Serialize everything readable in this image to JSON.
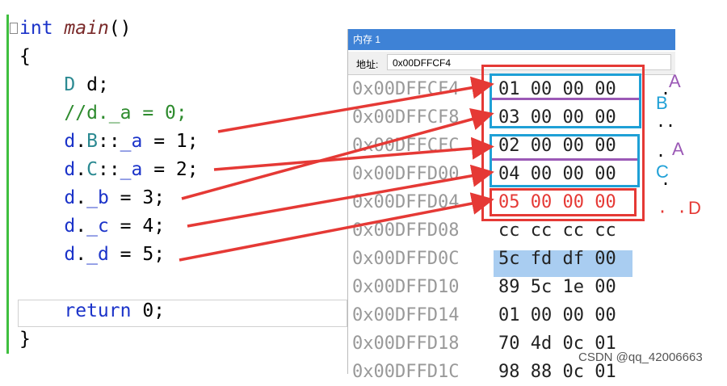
{
  "editor": {
    "lines": [
      {
        "parts": [
          {
            "t": "int",
            "c": "kw"
          },
          {
            "t": " ",
            "c": ""
          },
          {
            "t": "main",
            "c": "fn"
          },
          {
            "t": "()",
            "c": ""
          }
        ]
      },
      {
        "parts": [
          {
            "t": "{",
            "c": ""
          }
        ]
      },
      {
        "parts": [
          {
            "t": "    ",
            "c": ""
          },
          {
            "t": "D",
            "c": "ty"
          },
          {
            "t": " d;",
            "c": ""
          }
        ]
      },
      {
        "parts": [
          {
            "t": "    ",
            "c": ""
          },
          {
            "t": "//d._a = 0;",
            "c": "cm"
          }
        ]
      },
      {
        "parts": [
          {
            "t": "    ",
            "c": ""
          },
          {
            "t": "d",
            "c": "id"
          },
          {
            "t": ".",
            "c": ""
          },
          {
            "t": "B",
            "c": "ty"
          },
          {
            "t": "::",
            "c": ""
          },
          {
            "t": "_a",
            "c": "id"
          },
          {
            "t": " = 1;",
            "c": ""
          }
        ]
      },
      {
        "parts": [
          {
            "t": "    ",
            "c": ""
          },
          {
            "t": "d",
            "c": "id"
          },
          {
            "t": ".",
            "c": ""
          },
          {
            "t": "C",
            "c": "ty"
          },
          {
            "t": "::",
            "c": ""
          },
          {
            "t": "_a",
            "c": "id"
          },
          {
            "t": " = 2;",
            "c": ""
          }
        ]
      },
      {
        "parts": [
          {
            "t": "    ",
            "c": ""
          },
          {
            "t": "d",
            "c": "id"
          },
          {
            "t": ".",
            "c": ""
          },
          {
            "t": "_b",
            "c": "id"
          },
          {
            "t": " = 3;",
            "c": ""
          }
        ]
      },
      {
        "parts": [
          {
            "t": "    ",
            "c": ""
          },
          {
            "t": "d",
            "c": "id"
          },
          {
            "t": ".",
            "c": ""
          },
          {
            "t": "_c",
            "c": "id"
          },
          {
            "t": " = 4;",
            "c": ""
          }
        ]
      },
      {
        "parts": [
          {
            "t": "    ",
            "c": ""
          },
          {
            "t": "d",
            "c": "id"
          },
          {
            "t": ".",
            "c": ""
          },
          {
            "t": "_d",
            "c": "id"
          },
          {
            "t": " = 5;",
            "c": ""
          }
        ]
      },
      {
        "parts": [
          {
            "t": "",
            "c": ""
          }
        ]
      },
      {
        "parts": [
          {
            "t": "    ",
            "c": ""
          },
          {
            "t": "return",
            "c": "kw"
          },
          {
            "t": " 0;",
            "c": ""
          }
        ]
      },
      {
        "parts": [
          {
            "t": "}",
            "c": ""
          }
        ]
      }
    ]
  },
  "memory": {
    "title": "内存 1",
    "address_label": "地址:",
    "address_value": "0x00DFFCF4",
    "rows": [
      {
        "addr": "0x00DFFCF4",
        "bytes": "01 00 00 00"
      },
      {
        "addr": "0x00DFFCF8",
        "bytes": "03 00 00 00"
      },
      {
        "addr": "0x00DFFCFC",
        "bytes": "02 00 00 00"
      },
      {
        "addr": "0x00DFFD00",
        "bytes": "04 00 00 00"
      },
      {
        "addr": "0x00DFFD04",
        "bytes": "05 00 00 00"
      },
      {
        "addr": "0x00DFFD08",
        "bytes": "cc cc cc cc"
      },
      {
        "addr": "0x00DFFD0C",
        "bytes": "5c fd df 00"
      },
      {
        "addr": "0x00DFFD10",
        "bytes": "89 5c 1e 00"
      },
      {
        "addr": "0x00DFFD14",
        "bytes": "01 00 00 00"
      },
      {
        "addr": "0x00DFFD18",
        "bytes": "70 4d 0c 01"
      },
      {
        "addr": "0x00DFFD1C",
        "bytes": "98 88 0c 01"
      }
    ]
  },
  "annotations": {
    "labels": [
      {
        "text": "A",
        "color": "#9b59b6"
      },
      {
        "text": "B",
        "color": "#1fa0d6"
      },
      {
        "text": "A",
        "color": "#9b59b6"
      },
      {
        "text": "C",
        "color": "#1fa0d6"
      },
      {
        "text": "D",
        "color": "#e53935"
      }
    ],
    "dots": [
      ".",
      ".",
      "..",
      ".",
      ".",
      "· ·"
    ]
  },
  "colors": {
    "purple": "#9b59b6",
    "blue": "#1fa0d6",
    "red": "#e53935",
    "title_bar": "#3e82d6"
  },
  "watermark": "CSDN @qq_42006663"
}
